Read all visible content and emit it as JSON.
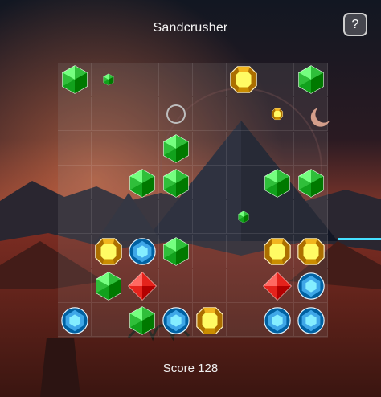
{
  "app": {
    "title": "Sandcrusher",
    "help_label": "?"
  },
  "score": {
    "text": "Score 128"
  },
  "board": {
    "rows": 8,
    "cols": 8,
    "grid": [
      [
        "green",
        "",
        "",
        "",
        "",
        "yellow",
        "",
        "green"
      ],
      [
        "",
        "",
        "",
        "",
        "",
        "",
        "",
        ""
      ],
      [
        "",
        "",
        "",
        "green",
        "",
        "",
        "",
        ""
      ],
      [
        "",
        "",
        "green",
        "green",
        "",
        "",
        "green",
        "green"
      ],
      [
        "",
        "",
        "",
        "",
        "",
        "",
        "",
        ""
      ],
      [
        "",
        "yellow",
        "blue",
        "green",
        "",
        "",
        "yellow",
        "yellow"
      ],
      [
        "",
        "green",
        "red",
        "",
        "",
        "",
        "red",
        "blue"
      ],
      [
        "blue",
        "",
        "green",
        "blue",
        "yellow",
        "",
        "blue",
        "blue"
      ]
    ],
    "small_gems": [
      {
        "color": "green",
        "row": 0,
        "col": 1
      },
      {
        "color": "yellow",
        "row": 1,
        "col": 6
      },
      {
        "color": "green",
        "row": 4,
        "col": 5
      }
    ],
    "selection": {
      "row": 1,
      "col": 3
    }
  },
  "colors": {
    "green": "#2fbf3a",
    "yellow": "#f2b51e",
    "blue": "#3ea7e8",
    "red": "#e5231c"
  }
}
